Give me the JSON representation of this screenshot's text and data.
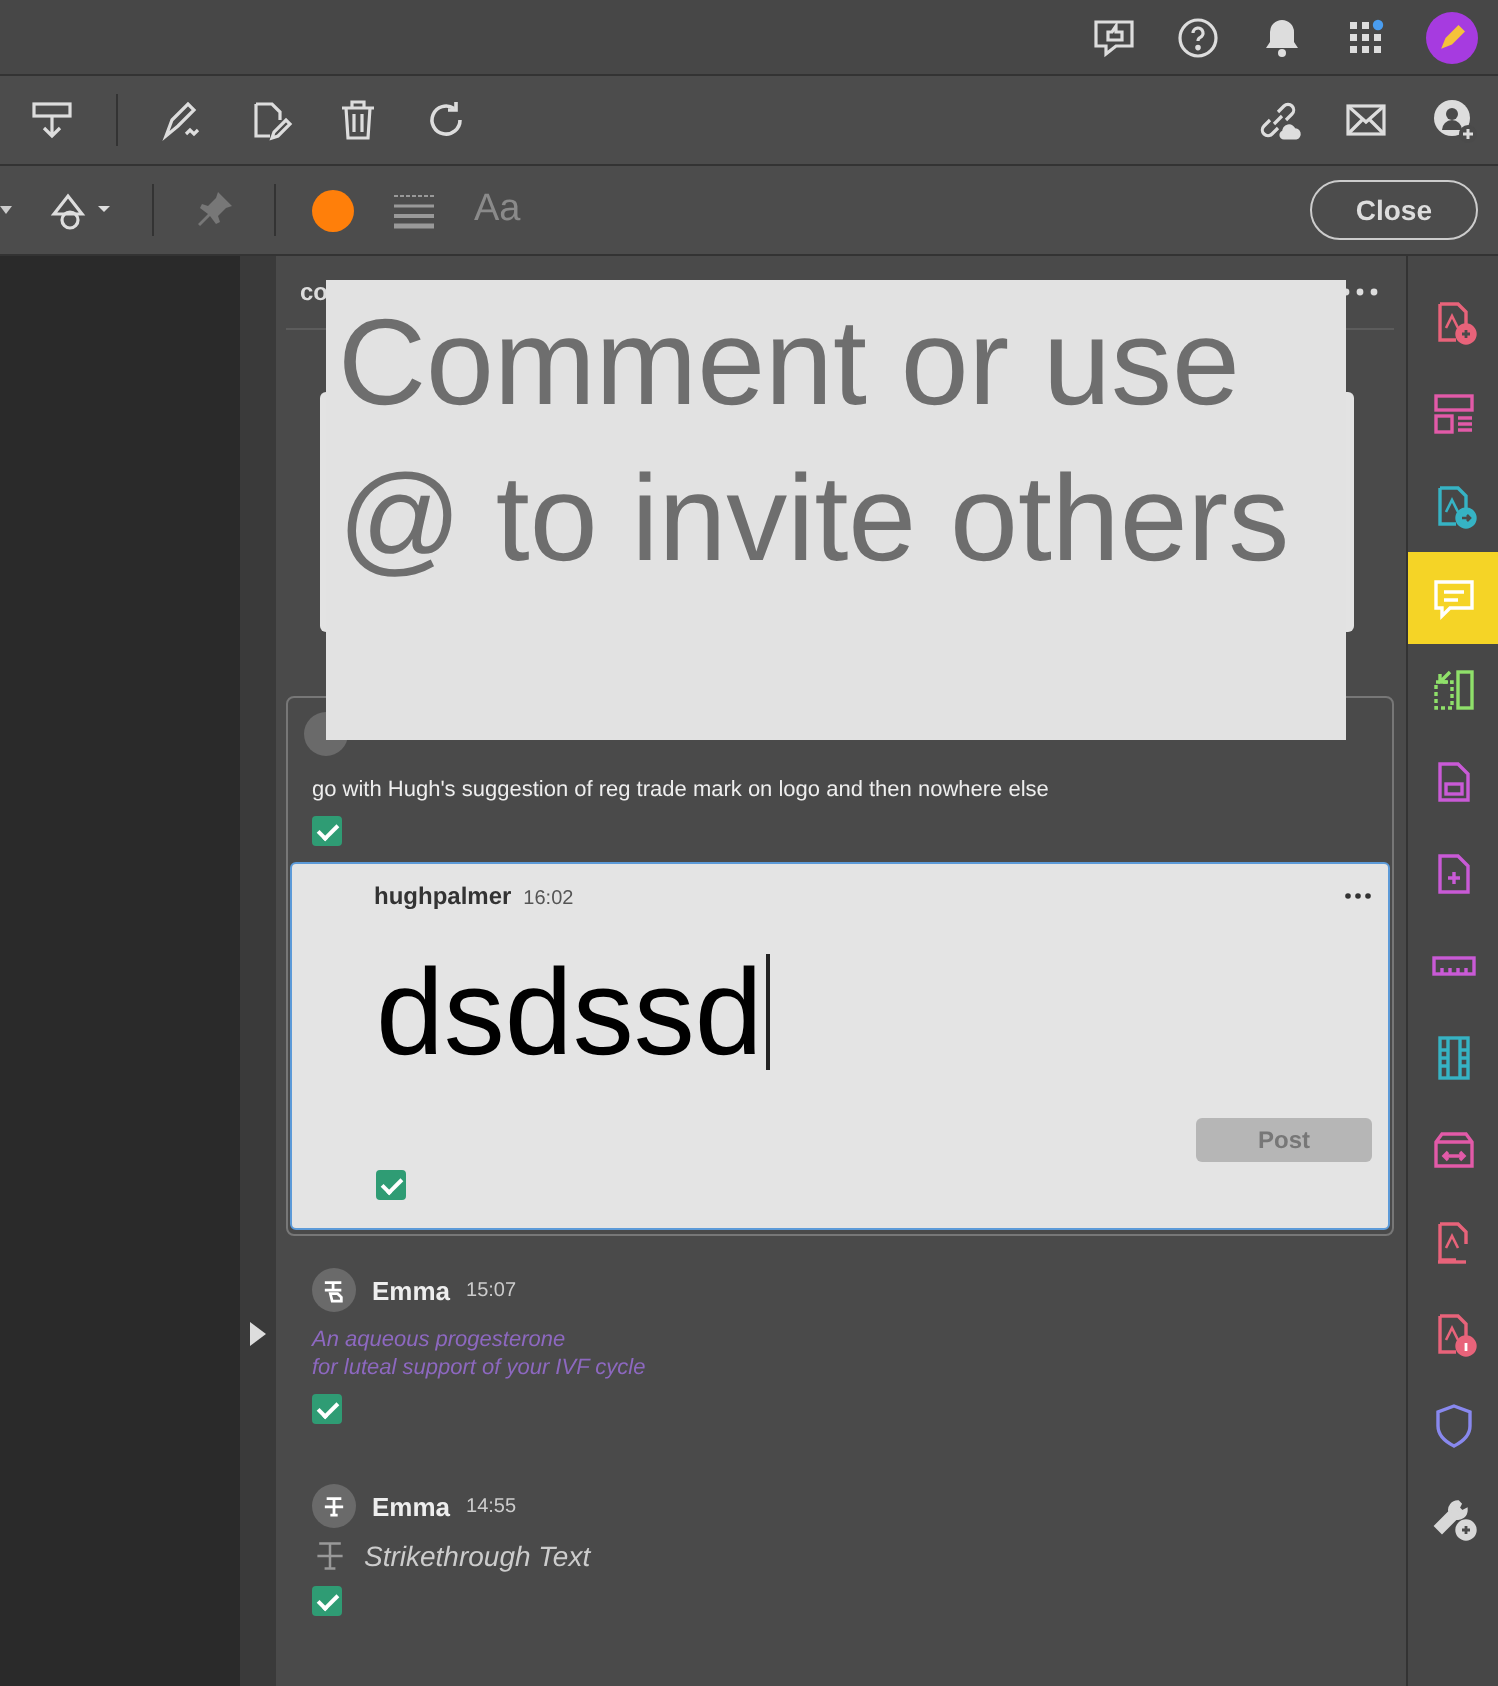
{
  "toolbar": {
    "color_swatch": {
      "color": "#ff7f0a"
    },
    "text_tool": "Aa",
    "close_button": "Close"
  },
  "comments_panel": {
    "header": "co",
    "placeholder_overlay": "Comment or use @ to invite others",
    "comments": [
      {
        "kind": "note",
        "body": "go with Hugh's suggestion of reg trade mark on logo and then nowhere else",
        "checked": true,
        "reply": {
          "author": "hughpalmer",
          "time": "16:02",
          "value": "dsdssd",
          "post": "Post",
          "post_disabled": true,
          "checked": true
        }
      },
      {
        "kind": "replace",
        "author": "Emma",
        "time": "15:07",
        "lines": [
          "An aqueous progesterone",
          "for luteal support of your IVF cycle"
        ],
        "checked": true
      },
      {
        "kind": "strikethrough",
        "author": "Emma",
        "time": "14:55",
        "body": "Strikethrough Text",
        "checked": true
      }
    ]
  },
  "tool_rail": [
    {
      "color": "#e8637a",
      "selected": false
    },
    {
      "color": "#e25aa8",
      "selected": false
    },
    {
      "color": "#36b3c4",
      "selected": false
    },
    {
      "color": "#ffffff",
      "selected": true
    },
    {
      "color": "#8fe06a",
      "selected": false
    },
    {
      "color": "#c95ad6",
      "selected": false
    },
    {
      "color": "#c95ad6",
      "selected": false
    },
    {
      "color": "#c95ad6",
      "selected": false
    },
    {
      "color": "#36b3c4",
      "selected": false
    },
    {
      "color": "#e25aa8",
      "selected": false
    },
    {
      "color": "#e8637a",
      "selected": false
    },
    {
      "color": "#e8637a",
      "selected": false
    },
    {
      "color": "#8888ee",
      "selected": false
    },
    {
      "color": "#d8d8d8",
      "selected": false
    }
  ]
}
